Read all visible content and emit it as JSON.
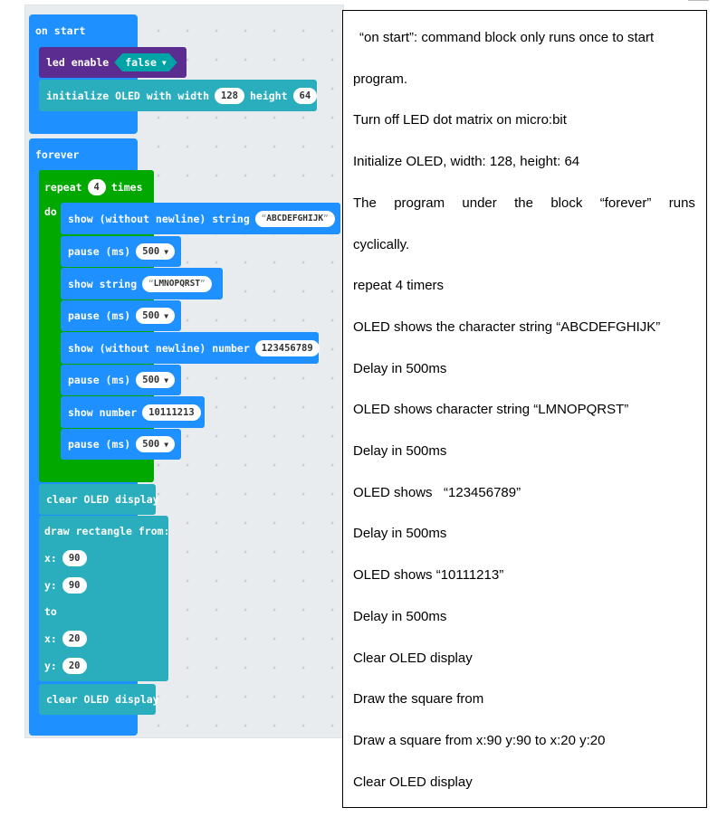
{
  "workspace": {
    "on_start": {
      "hat_label": "on start",
      "led_enable": {
        "label": "led enable",
        "value": "false"
      },
      "init_oled": {
        "label": "initialize OLED with width",
        "width": "128",
        "height_label": "height",
        "height": "64"
      }
    },
    "forever": {
      "hat_label": "forever",
      "repeat": {
        "label": "repeat",
        "count": "4",
        "times_label": "times",
        "do_label": "do"
      },
      "statements": {
        "show_string_nonl": {
          "label": "show (without newline) string",
          "value": "ABCDEFGHIJK"
        },
        "pause1": {
          "label": "pause (ms)",
          "value": "500"
        },
        "show_string": {
          "label": "show string",
          "value": "LMNOPQRST"
        },
        "pause2": {
          "label": "pause (ms)",
          "value": "500"
        },
        "show_number_nonl": {
          "label": "show (without newline) number",
          "value": "123456789"
        },
        "pause3": {
          "label": "pause (ms)",
          "value": "500"
        },
        "show_number": {
          "label": "show number",
          "value": "10111213"
        },
        "pause4": {
          "label": "pause (ms)",
          "value": "500"
        }
      },
      "clear1": "clear OLED display",
      "rect": {
        "label": "draw rectangle from:",
        "x_label": "x:",
        "x1": "90",
        "y_label": "y:",
        "y1": "90",
        "to_label": "to",
        "x2": "20",
        "y2": "20"
      },
      "clear2": "clear OLED display"
    },
    "colors": {
      "event": "#1e90ff",
      "loop": "#00a800",
      "oled": "#2aaebd",
      "led": "#5c2d91",
      "background": "#e9ecef"
    }
  },
  "notes": {
    "line1": "“on start”: command block only runs once to start",
    "line2": "program.",
    "line3": "Turn off LED dot matrix on micro:bit",
    "line4": "Initialize OLED, width: 128, height: 64",
    "line5_words": [
      "The",
      "program",
      "under",
      "the",
      "block",
      "“forever”",
      "runs"
    ],
    "line6": "cyclically.",
    "line7": "repeat 4 timers",
    "line8": "OLED shows the character string “ABCDEFGHIJK”",
    "line9": "Delay in 500ms",
    "line10": "OLED shows character string “LMNOPQRST”",
    "line11": "Delay in 500ms",
    "line12": "OLED shows   “123456789”",
    "line13": "Delay in 500ms",
    "line14": "OLED shows “10111213”",
    "line15": "Delay in 500ms",
    "line16": "Clear OLED display",
    "line17": "Draw the square from",
    "line18": "Draw a square from x:90 y:90 to x:20 y:20",
    "line19": "Clear OLED display"
  }
}
